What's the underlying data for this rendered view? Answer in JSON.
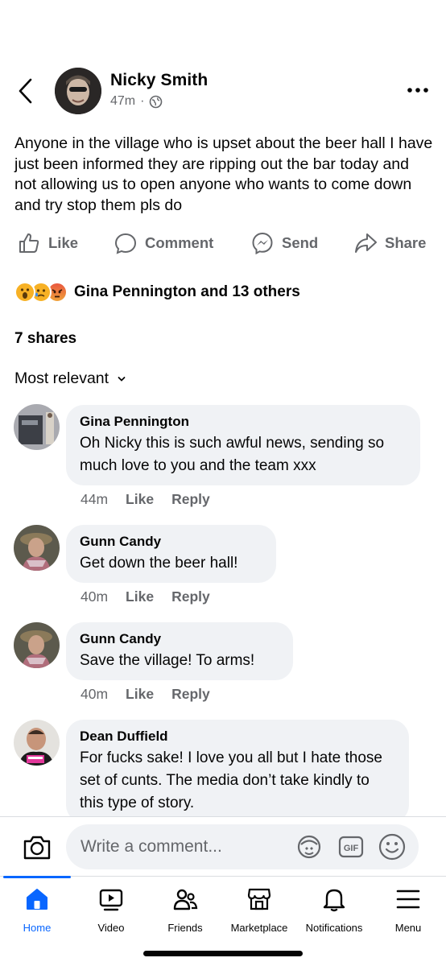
{
  "post": {
    "author": "Nicky Smith",
    "time": "47m",
    "audience_icon": "globe-icon",
    "text": "Anyone in the village who is upset about the beer hall I have just been informed they are ripping out the bar today and not allowing us to open anyone who wants to come down and try stop them pls do"
  },
  "actions": {
    "like": "Like",
    "comment": "Comment",
    "send": "Send",
    "share": "Share"
  },
  "reactions": {
    "emojis": [
      "wow-emoji",
      "sad-emoji",
      "angry-emoji"
    ],
    "label": "Gina Pennington and 13 others"
  },
  "shares": "7 shares",
  "sort": {
    "label": "Most relevant"
  },
  "comments": [
    {
      "name": "Gina Pennington",
      "text": "Oh Nicky this is such awful news, sending so much love to you and the team xxx",
      "time": "44m",
      "like": "Like",
      "reply": "Reply"
    },
    {
      "name": "Gunn Candy",
      "text": "Get down the beer hall!",
      "time": "40m",
      "like": "Like",
      "reply": "Reply"
    },
    {
      "name": "Gunn Candy",
      "text": "Save the village! To arms!",
      "time": "40m",
      "like": "Like",
      "reply": "Reply"
    },
    {
      "name": "Dean Duffield",
      "text": "For fucks sake! I love you all but I hate those set of cunts. The media don’t take kindly to this type of story."
    }
  ],
  "composer": {
    "placeholder": "Write a comment..."
  },
  "tabs": [
    {
      "label": "Home",
      "icon": "home-icon",
      "active": true
    },
    {
      "label": "Video",
      "icon": "video-icon"
    },
    {
      "label": "Friends",
      "icon": "friends-icon"
    },
    {
      "label": "Marketplace",
      "icon": "marketplace-icon"
    },
    {
      "label": "Notifications",
      "icon": "bell-icon"
    },
    {
      "label": "Menu",
      "icon": "menu-icon"
    }
  ],
  "colors": {
    "accent": "#0866ff",
    "secondary_text": "#65676b",
    "bubble": "#f0f2f5"
  }
}
